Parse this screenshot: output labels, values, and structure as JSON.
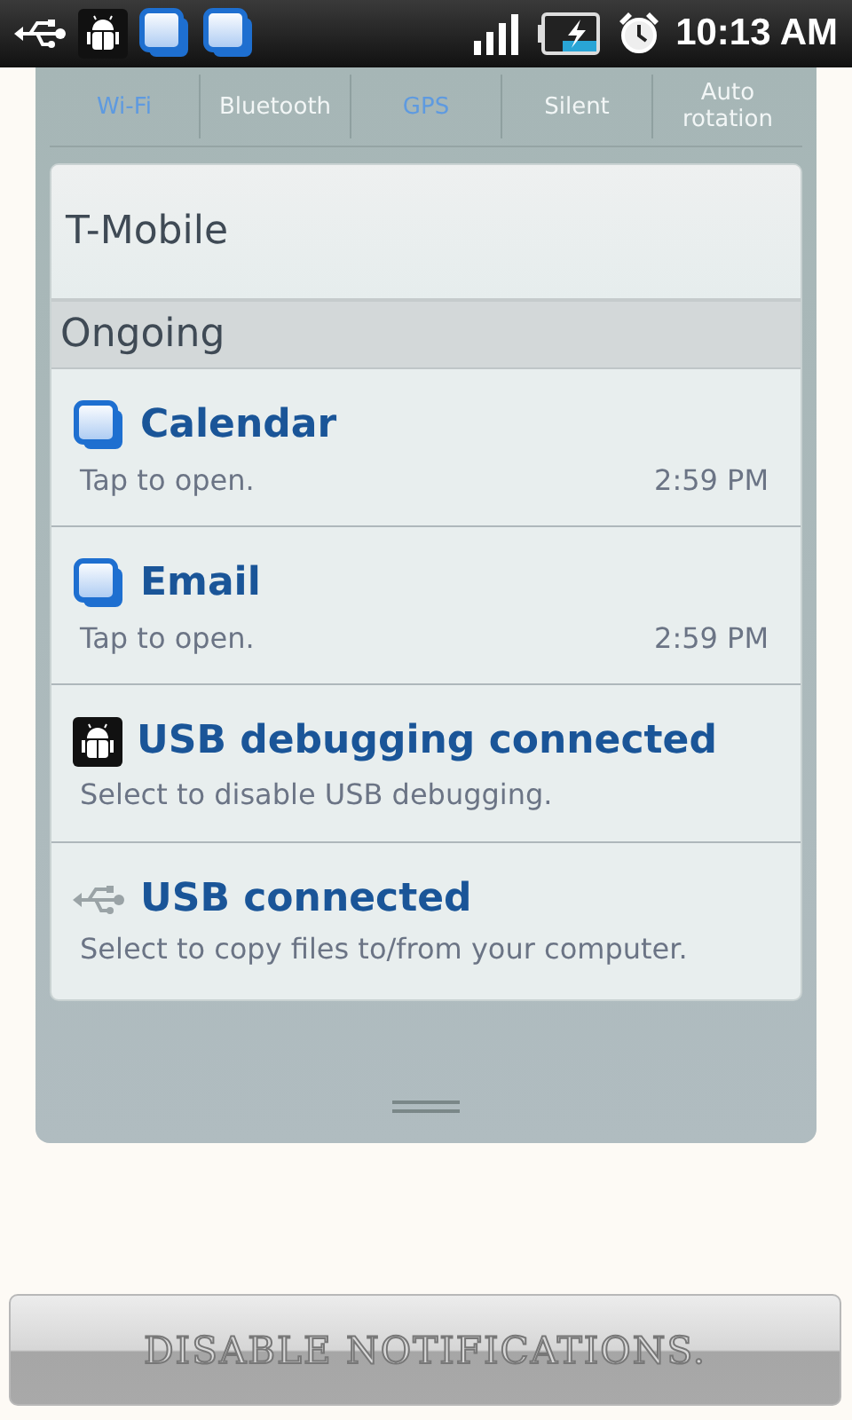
{
  "status_bar": {
    "notification_icons": [
      {
        "kind": "usb"
      },
      {
        "kind": "android"
      },
      {
        "kind": "stack"
      },
      {
        "kind": "stack"
      }
    ],
    "time": "10:13 AM"
  },
  "toggles": [
    {
      "label": "Wi-Fi",
      "on": true
    },
    {
      "label": "Bluetooth",
      "on": false
    },
    {
      "label": "GPS",
      "on": true
    },
    {
      "label": "Silent",
      "on": false
    },
    {
      "label": "Auto rotation",
      "on": false
    }
  ],
  "carrier": "T-Mobile",
  "section": "Ongoing",
  "notifications": [
    {
      "kind": "stack",
      "title": "Calendar",
      "text": "Tap to open.",
      "time": "2:59 PM"
    },
    {
      "kind": "stack",
      "title": "Email",
      "text": "Tap to open.",
      "time": "2:59 PM"
    },
    {
      "kind": "android",
      "title": "USB debugging connected",
      "text": "Select to disable USB debugging."
    },
    {
      "kind": "usb",
      "title": "USB connected",
      "text": "Select to copy files to/from your computer."
    }
  ],
  "button": "DISABLE NOTIFICATIONS."
}
